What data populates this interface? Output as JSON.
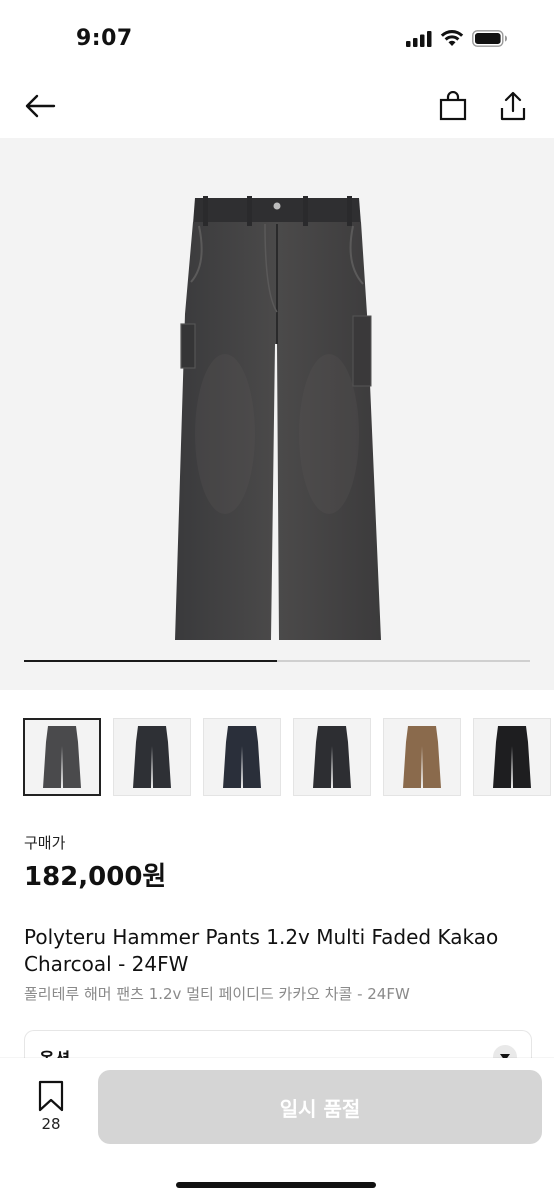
{
  "status_bar": {
    "time": "9:07",
    "icons": [
      "signal-icon",
      "wifi-icon",
      "battery-icon"
    ]
  },
  "nav": {
    "icons": [
      "back-arrow-icon",
      "shopping-bag-icon",
      "share-icon"
    ]
  },
  "carousel": {
    "progress": 0.5
  },
  "thumbnails": [
    {
      "color": "#4a4a4c",
      "selected": true
    },
    {
      "color": "#2e3035",
      "selected": false
    },
    {
      "color": "#2a2f3a",
      "selected": false
    },
    {
      "color": "#2d2e32",
      "selected": false
    },
    {
      "color": "#8a6a4c",
      "selected": false
    },
    {
      "color": "#1e1e20",
      "selected": false
    }
  ],
  "price": {
    "label": "구매가",
    "value": "182,000원"
  },
  "product": {
    "title_en": "Polyteru Hammer Pants 1.2v Multi Faded Kakao Charcoal - 24FW",
    "title_ko": "폴리테루 해머 팬츠 1.2v 멀티 페이디드 카카오 차콜 - 24FW"
  },
  "options": {
    "label": "옵션"
  },
  "bottom_bar": {
    "bookmark_count": "28",
    "sold_out_label": "일시 품절"
  },
  "colors": {
    "button_disabled": "#d5d5d5",
    "hero_bg": "#f3f3f3"
  }
}
